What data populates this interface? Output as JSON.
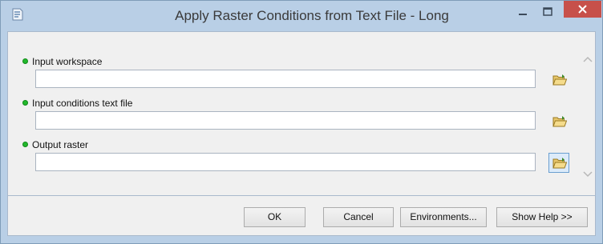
{
  "window": {
    "title": "Apply Raster Conditions from Text File - Long",
    "icon": "python-script-icon",
    "controls": {
      "minimize": "minimize-icon",
      "maximize": "maximize-icon",
      "close": "close-icon"
    },
    "close_color": "#c7504a"
  },
  "parameters": [
    {
      "label": "Input workspace",
      "value": "",
      "required": true
    },
    {
      "label": "Input conditions text file",
      "value": "",
      "required": true
    },
    {
      "label": "Output raster",
      "value": "",
      "required": true
    }
  ],
  "required_indicator_color": "#22b82c",
  "footer": {
    "ok_label": "OK",
    "cancel_label": "Cancel",
    "environments_label": "Environments...",
    "help_label": "Show Help >>"
  }
}
